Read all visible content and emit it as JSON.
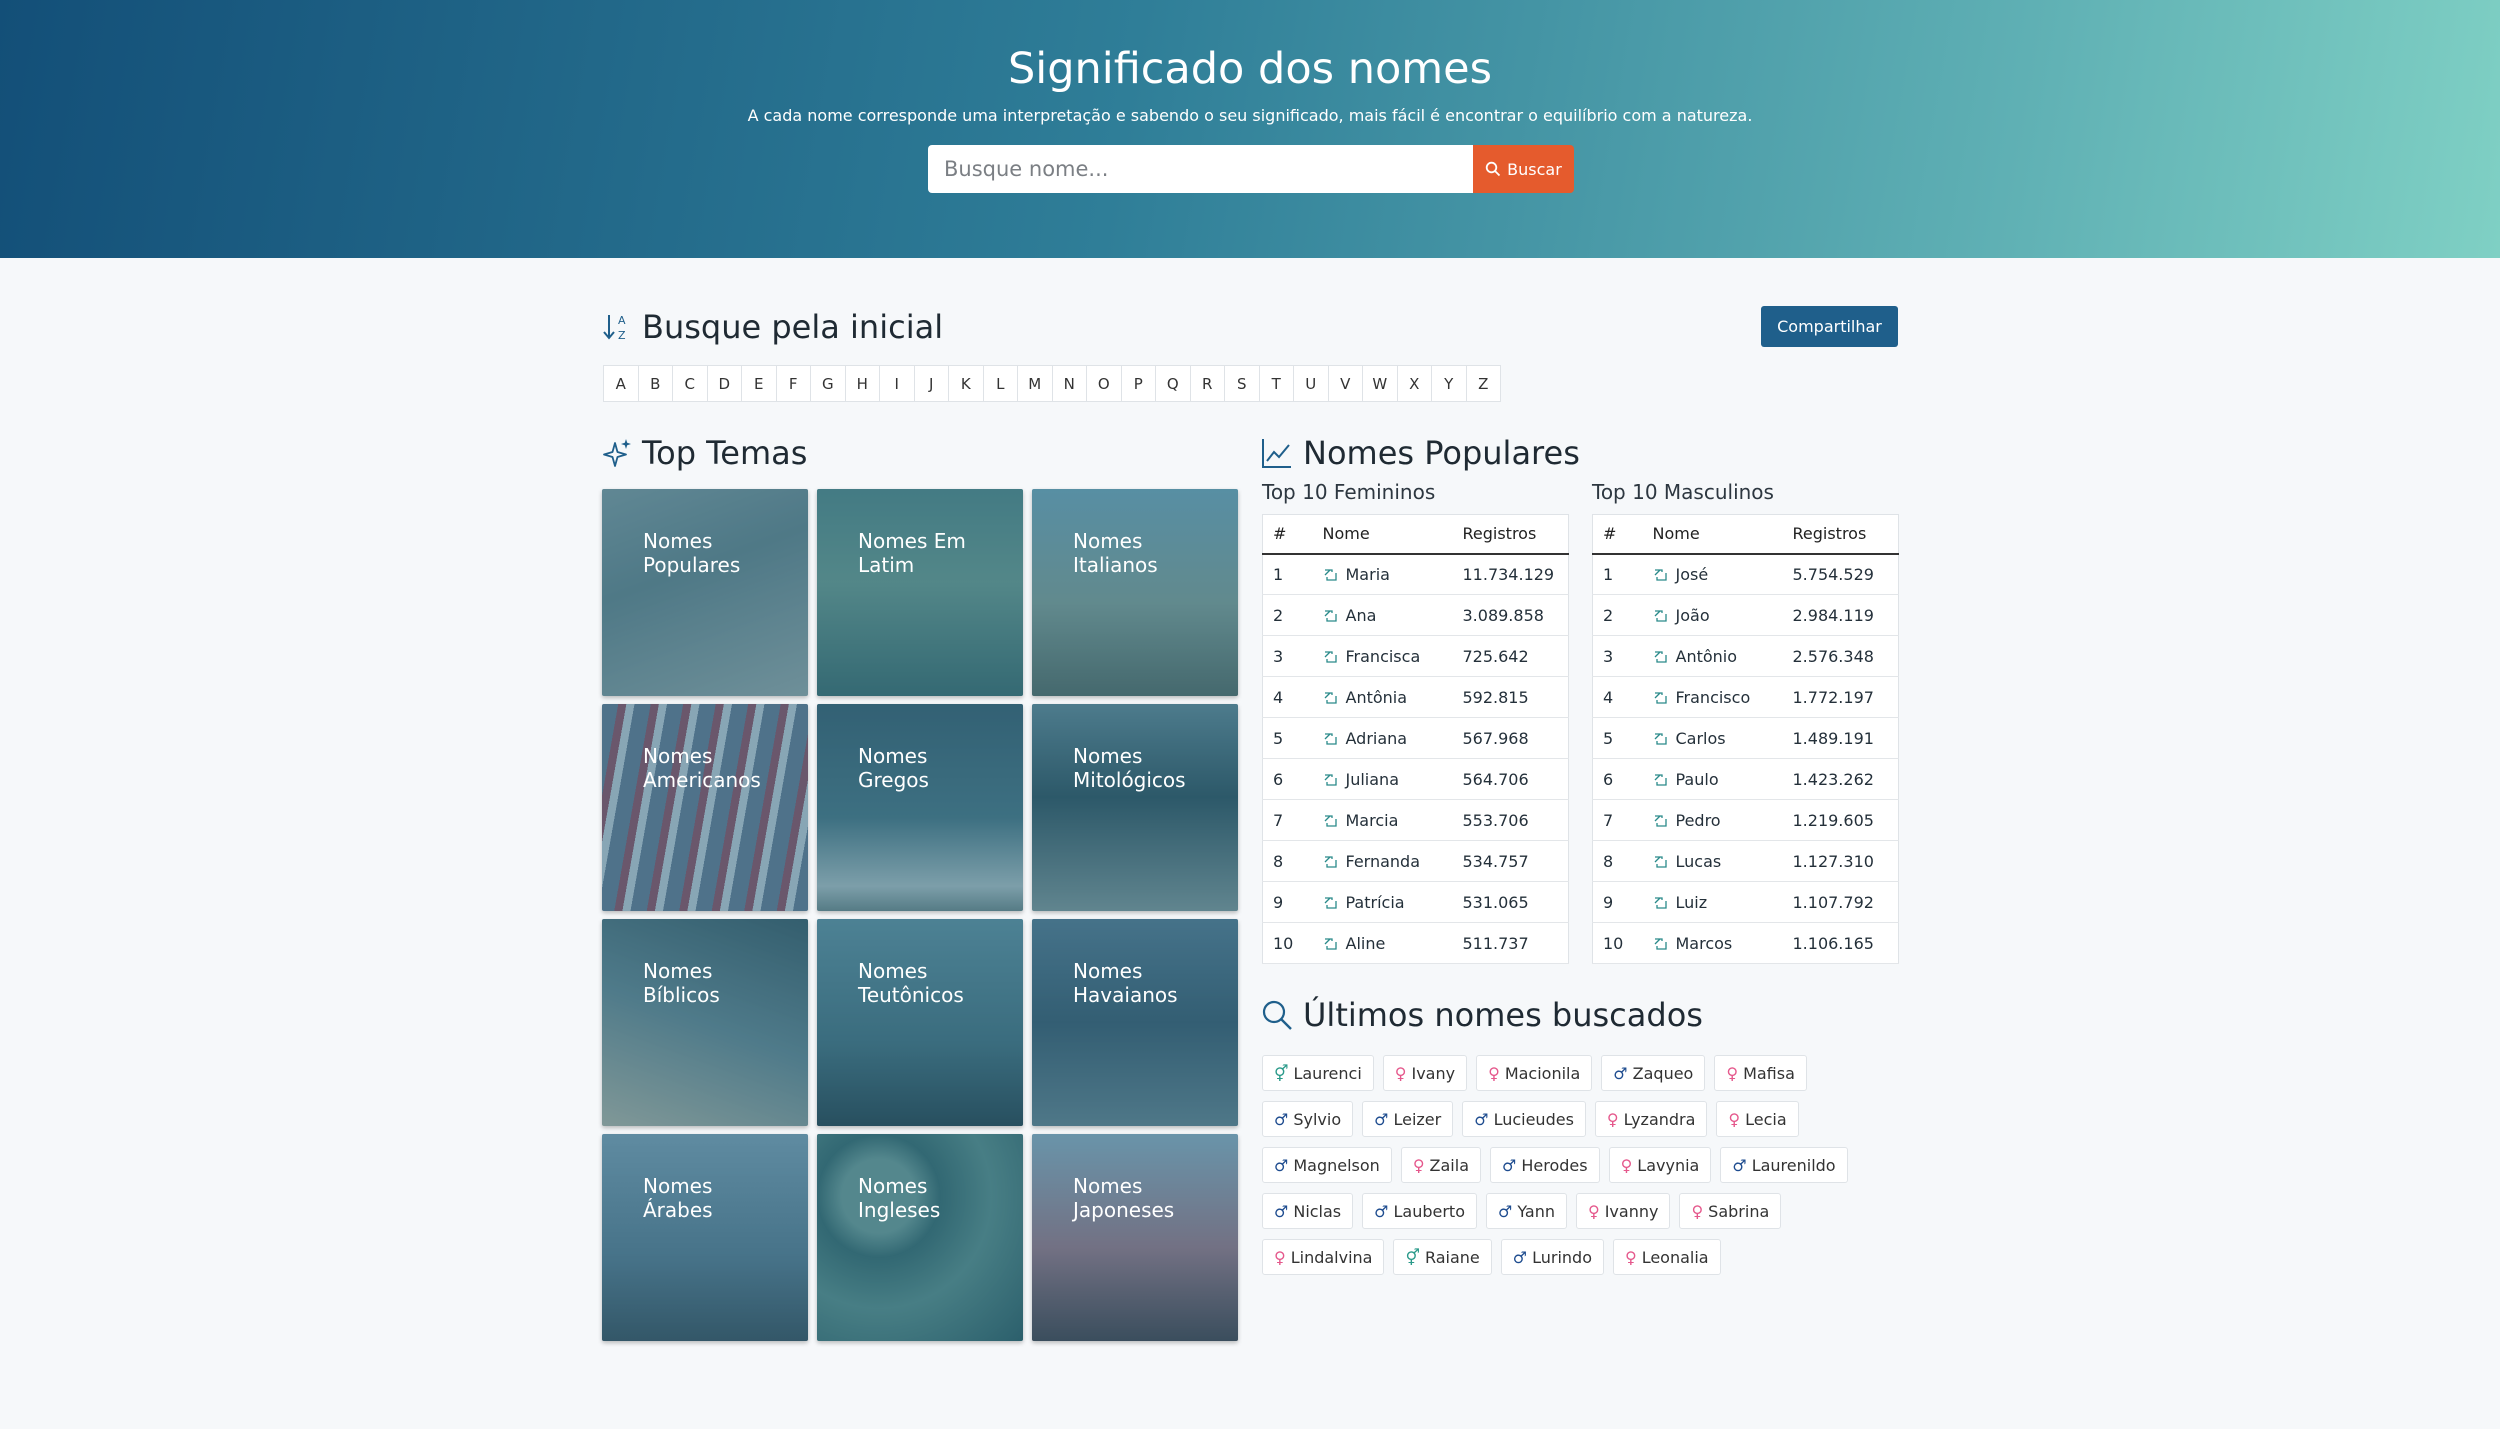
{
  "hero": {
    "title": "Significado dos nomes",
    "subtitle": "A cada nome corresponde uma interpretação e sabendo o seu significado, mais fácil é encontrar o equilíbrio com a natureza.",
    "search_placeholder": "Busque nome...",
    "search_button": "Buscar",
    "colors": {
      "gradient_start": "#134f78",
      "gradient_end": "#7fd0c4",
      "button": "#e55b2d"
    }
  },
  "initial": {
    "title": "Busque pela inicial",
    "share_button": "Compartilhar",
    "letters": [
      "A",
      "B",
      "C",
      "D",
      "E",
      "F",
      "G",
      "H",
      "I",
      "J",
      "K",
      "L",
      "M",
      "N",
      "O",
      "P",
      "Q",
      "R",
      "S",
      "T",
      "U",
      "V",
      "W",
      "X",
      "Y",
      "Z"
    ]
  },
  "themes": {
    "title": "Top Temas",
    "items": [
      {
        "label": "Nomes Populares"
      },
      {
        "label": "Nomes Em Latim"
      },
      {
        "label": "Nomes Italianos"
      },
      {
        "label": "Nomes Americanos"
      },
      {
        "label": "Nomes Gregos"
      },
      {
        "label": "Nomes Mitológicos"
      },
      {
        "label": "Nomes Bíblicos"
      },
      {
        "label": "Nomes Teutônicos"
      },
      {
        "label": "Nomes Havaianos"
      },
      {
        "label": "Nomes Árabes"
      },
      {
        "label": "Nomes Ingleses"
      },
      {
        "label": "Nomes Japoneses"
      }
    ]
  },
  "popular": {
    "title": "Nomes Populares",
    "female_title": "Top 10 Femininos",
    "male_title": "Top 10 Masculinos",
    "headers": [
      "#",
      "Nome",
      "Registros"
    ],
    "female": [
      [
        "1",
        "Maria",
        "11.734.129"
      ],
      [
        "2",
        "Ana",
        "3.089.858"
      ],
      [
        "3",
        "Francisca",
        "725.642"
      ],
      [
        "4",
        "Antônia",
        "592.815"
      ],
      [
        "5",
        "Adriana",
        "567.968"
      ],
      [
        "6",
        "Juliana",
        "564.706"
      ],
      [
        "7",
        "Marcia",
        "553.706"
      ],
      [
        "8",
        "Fernanda",
        "534.757"
      ],
      [
        "9",
        "Patrícia",
        "531.065"
      ],
      [
        "10",
        "Aline",
        "511.737"
      ]
    ],
    "male": [
      [
        "1",
        "José",
        "5.754.529"
      ],
      [
        "2",
        "João",
        "2.984.119"
      ],
      [
        "3",
        "Antônio",
        "2.576.348"
      ],
      [
        "4",
        "Francisco",
        "1.772.197"
      ],
      [
        "5",
        "Carlos",
        "1.489.191"
      ],
      [
        "6",
        "Paulo",
        "1.423.262"
      ],
      [
        "7",
        "Pedro",
        "1.219.605"
      ],
      [
        "8",
        "Lucas",
        "1.127.310"
      ],
      [
        "9",
        "Luiz",
        "1.107.792"
      ],
      [
        "10",
        "Marcos",
        "1.106.165"
      ]
    ]
  },
  "recent": {
    "title": "Últimos nomes buscados",
    "items": [
      {
        "name": "Laurenci",
        "gender": "u"
      },
      {
        "name": "Ivany",
        "gender": "f"
      },
      {
        "name": "Macionila",
        "gender": "f"
      },
      {
        "name": "Zaqueo",
        "gender": "m"
      },
      {
        "name": "Mafisa",
        "gender": "f"
      },
      {
        "name": "Sylvio",
        "gender": "m"
      },
      {
        "name": "Leizer",
        "gender": "m"
      },
      {
        "name": "Lucieudes",
        "gender": "m"
      },
      {
        "name": "Lyzandra",
        "gender": "f"
      },
      {
        "name": "Lecia",
        "gender": "f"
      },
      {
        "name": "Magnelson",
        "gender": "m"
      },
      {
        "name": "Zaila",
        "gender": "f"
      },
      {
        "name": "Herodes",
        "gender": "m"
      },
      {
        "name": "Lavynia",
        "gender": "f"
      },
      {
        "name": "Laurenildo",
        "gender": "m"
      },
      {
        "name": "Niclas",
        "gender": "m"
      },
      {
        "name": "Lauberto",
        "gender": "m"
      },
      {
        "name": "Yann",
        "gender": "m"
      },
      {
        "name": "Ivanny",
        "gender": "f"
      },
      {
        "name": "Sabrina",
        "gender": "f"
      },
      {
        "name": "Lindalvina",
        "gender": "f"
      },
      {
        "name": "Raiane",
        "gender": "u"
      },
      {
        "name": "Lurindo",
        "gender": "m"
      },
      {
        "name": "Leonalia",
        "gender": "f"
      }
    ]
  }
}
